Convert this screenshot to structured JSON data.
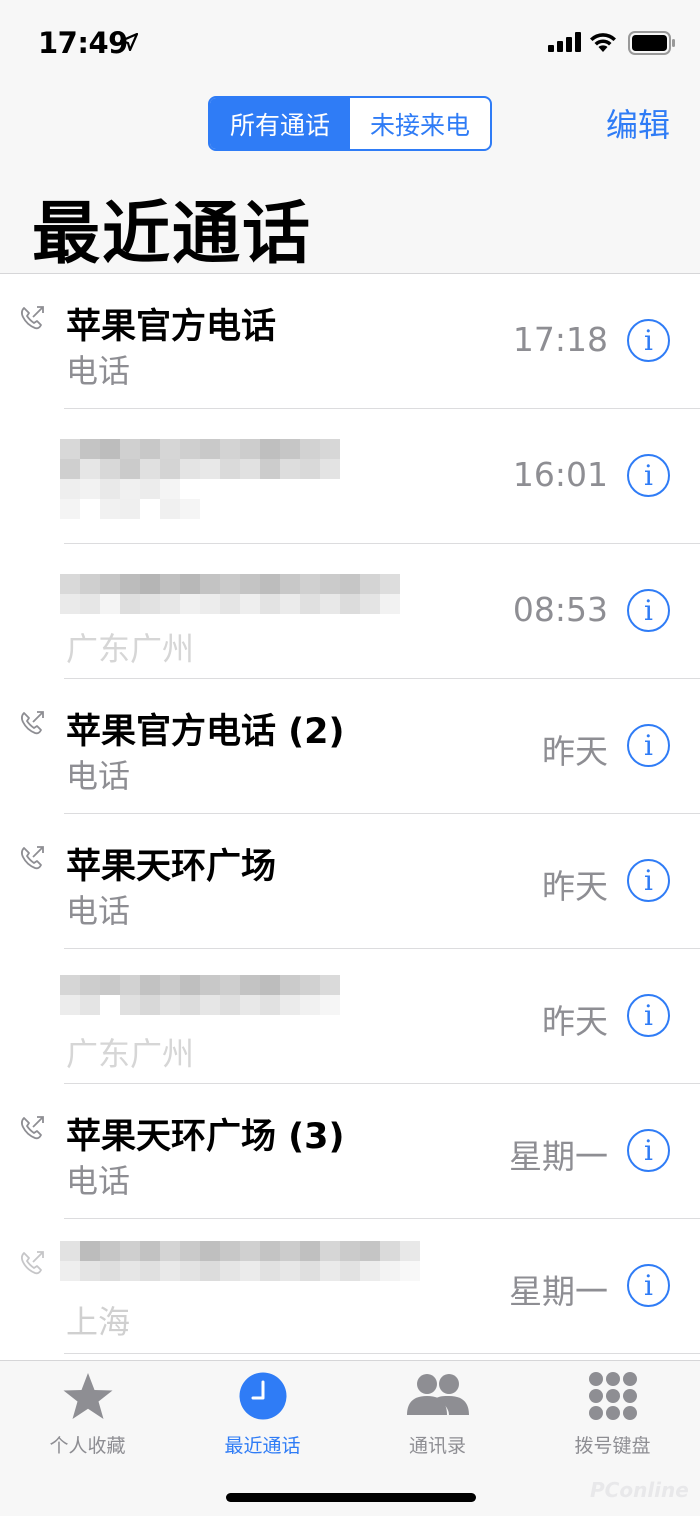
{
  "status": {
    "time": "17:49"
  },
  "header": {
    "segments": [
      "所有通话",
      "未接来电"
    ],
    "edit_label": "编辑",
    "title": "最近通话"
  },
  "calls": [
    {
      "name": "苹果官方电话",
      "subtitle": "电话",
      "time": "17:18",
      "outgoing": true,
      "redacted": false
    },
    {
      "name": "",
      "subtitle": "",
      "time": "16:01",
      "outgoing": false,
      "redacted": true
    },
    {
      "name": "",
      "subtitle": "广东广州",
      "time": "08:53",
      "outgoing": false,
      "redacted": true
    },
    {
      "name": "苹果官方电话 (2)",
      "subtitle": "电话",
      "time": "昨天",
      "outgoing": true,
      "redacted": false
    },
    {
      "name": "苹果天环广场",
      "subtitle": "电话",
      "time": "昨天",
      "outgoing": true,
      "redacted": false
    },
    {
      "name": "",
      "subtitle": "广东广州",
      "time": "昨天",
      "outgoing": false,
      "redacted": true
    },
    {
      "name": "苹果天环广场 (3)",
      "subtitle": "电话",
      "time": "星期一",
      "outgoing": true,
      "redacted": false
    },
    {
      "name": "",
      "subtitle": "上海",
      "time": "星期一",
      "outgoing": true,
      "redacted": true
    }
  ],
  "tabbar": {
    "tabs": [
      {
        "label": "个人收藏",
        "icon": "star-icon",
        "active": false
      },
      {
        "label": "最近通话",
        "icon": "clock-icon",
        "active": true
      },
      {
        "label": "通讯录",
        "icon": "contacts-icon",
        "active": false
      },
      {
        "label": "拨号键盘",
        "icon": "keypad-icon",
        "active": false
      }
    ]
  },
  "watermark": "PConline",
  "colors": {
    "accent": "#2f7cf6",
    "secondary_text": "#8e8e93"
  }
}
